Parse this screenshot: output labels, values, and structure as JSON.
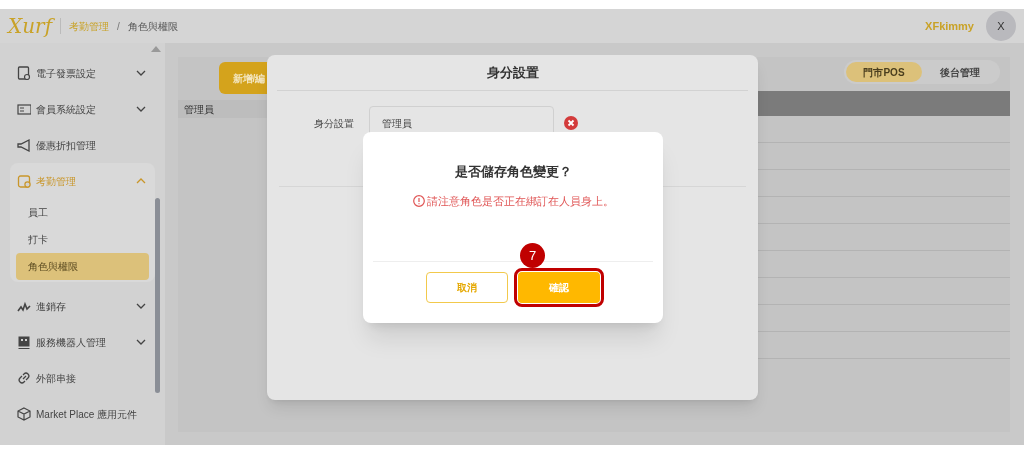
{
  "header": {
    "logo": "Xurf",
    "breadcrumb": [
      {
        "label": "考勤管理",
        "current": false
      },
      {
        "label": "角色與權限",
        "current": true
      }
    ],
    "separator": "/",
    "user": "XFkimmy",
    "avatar": "X"
  },
  "sidebar": {
    "items": [
      {
        "label": "電子發票設定",
        "kind": "group",
        "expanded": false
      },
      {
        "label": "會員系統設定",
        "kind": "group",
        "expanded": false
      },
      {
        "label": "優惠折扣管理",
        "kind": "link"
      },
      {
        "label": "考勤管理",
        "kind": "group",
        "expanded": true,
        "children": [
          {
            "label": "員工",
            "selected": false
          },
          {
            "label": "打卡",
            "selected": false
          },
          {
            "label": "角色與權限",
            "selected": true
          }
        ]
      },
      {
        "label": "進銷存",
        "kind": "group",
        "expanded": false
      },
      {
        "label": "服務機器人管理",
        "kind": "group",
        "expanded": false
      },
      {
        "label": "外部串接",
        "kind": "link"
      },
      {
        "label": "Market Place 應用元件",
        "kind": "link"
      }
    ]
  },
  "content": {
    "add_button": "新增/編",
    "roles": [
      "管理員"
    ],
    "mode_tabs": [
      {
        "label": "門市POS",
        "selected": true
      },
      {
        "label": "後台管理",
        "selected": false
      }
    ]
  },
  "role_dialog": {
    "title": "身分設置",
    "field_label": "身分設置",
    "field_value": "管理員"
  },
  "confirm_dialog": {
    "title": "是否儲存角色變更？",
    "warning": "請注意角色是否正在綁訂在人員身上。",
    "buttons": [
      {
        "label": "取消",
        "kind": "secondary",
        "highlighted": false
      },
      {
        "label": "確認",
        "kind": "primary",
        "highlighted": true
      }
    ],
    "step_badge": "7"
  }
}
